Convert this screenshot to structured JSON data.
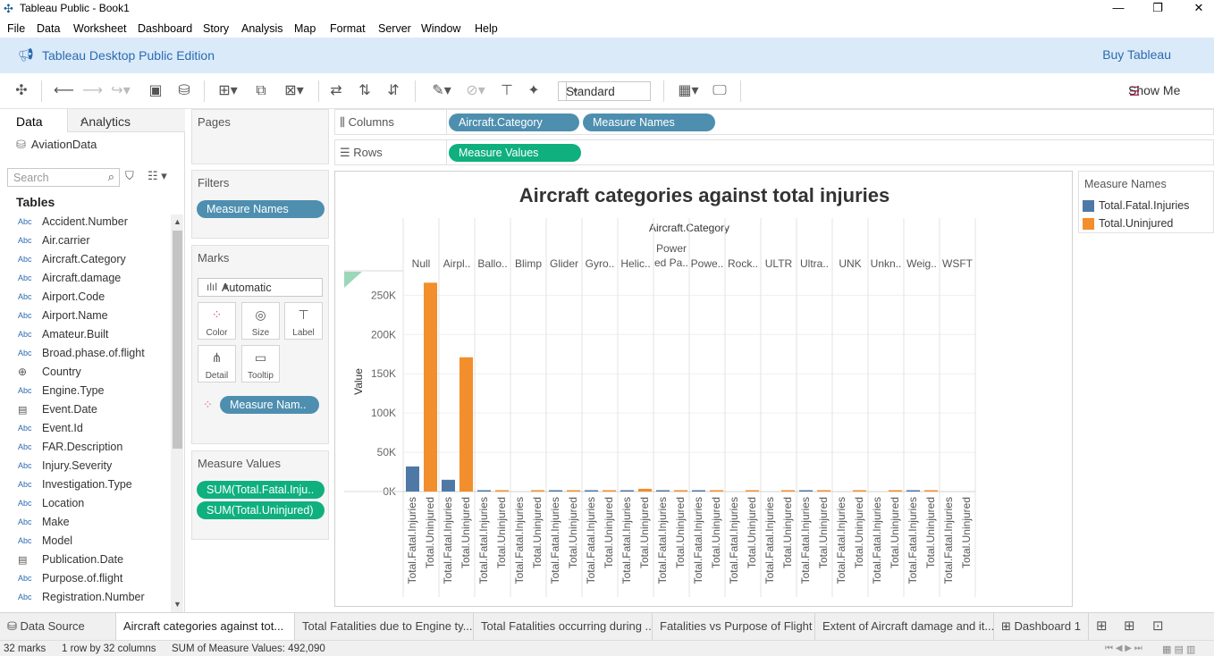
{
  "window": {
    "title": "Tableau Public - Book1",
    "minimize": "—",
    "restore": "❐",
    "close": "✕"
  },
  "menu": [
    "File",
    "Data",
    "Worksheet",
    "Dashboard",
    "Story",
    "Analysis",
    "Map",
    "Format",
    "Server",
    "Window",
    "Help"
  ],
  "banner": {
    "edition": "Tableau Desktop Public Edition",
    "buy": "Buy Tableau"
  },
  "toolbar": {
    "fit": "Standard",
    "show_me": "Show Me"
  },
  "data_pane": {
    "tab_data": "Data",
    "tab_analytics": "Analytics",
    "datasource": "AviationData",
    "search_placeholder": "Search",
    "tables_header": "Tables",
    "fields": [
      {
        "type": "Abc",
        "name": "Accident.Number"
      },
      {
        "type": "Abc",
        "name": "Air.carrier"
      },
      {
        "type": "Abc",
        "name": "Aircraft.Category"
      },
      {
        "type": "Abc",
        "name": "Aircraft.damage"
      },
      {
        "type": "Abc",
        "name": "Airport.Code"
      },
      {
        "type": "Abc",
        "name": "Airport.Name"
      },
      {
        "type": "Abc",
        "name": "Amateur.Built"
      },
      {
        "type": "Abc",
        "name": "Broad.phase.of.flight"
      },
      {
        "type": "globe",
        "name": "Country"
      },
      {
        "type": "Abc",
        "name": "Engine.Type"
      },
      {
        "type": "date",
        "name": "Event.Date"
      },
      {
        "type": "Abc",
        "name": "Event.Id"
      },
      {
        "type": "Abc",
        "name": "FAR.Description"
      },
      {
        "type": "Abc",
        "name": "Injury.Severity"
      },
      {
        "type": "Abc",
        "name": "Investigation.Type"
      },
      {
        "type": "Abc",
        "name": "Location"
      },
      {
        "type": "Abc",
        "name": "Make"
      },
      {
        "type": "Abc",
        "name": "Model"
      },
      {
        "type": "date",
        "name": "Publication.Date"
      },
      {
        "type": "Abc",
        "name": "Purpose.of.flight"
      },
      {
        "type": "Abc",
        "name": "Registration.Number"
      }
    ]
  },
  "cards": {
    "pages": "Pages",
    "filters": "Filters",
    "filter_pill": "Measure Names",
    "marks": "Marks",
    "marks_type": "Automatic",
    "mark_buttons": [
      "Color",
      "Size",
      "Label",
      "Detail",
      "Tooltip"
    ],
    "marks_pill": "Measure Nam..",
    "measure_values": "Measure Values",
    "mv_pills": [
      "SUM(Total.Fatal.Inju..",
      "SUM(Total.Uninjured)"
    ]
  },
  "shelves": {
    "columns_label": "Columns",
    "rows_label": "Rows",
    "columns_pills": [
      "Aircraft.Category",
      "Measure Names"
    ],
    "rows_pills": [
      "Measure Values"
    ]
  },
  "legend": {
    "title": "Measure Names",
    "items": [
      {
        "name": "Total.Fatal.Injuries",
        "color": "#4e79a7"
      },
      {
        "name": "Total.Uninjured",
        "color": "#f28e2b"
      }
    ]
  },
  "chart_data": {
    "type": "bar",
    "title": "Aircraft categories against total injuries",
    "header": "Aircraft.Category",
    "ylabel": "Value",
    "ylim": [
      0,
      280000
    ],
    "yticks": [
      0,
      50000,
      100000,
      150000,
      200000,
      250000
    ],
    "ytick_labels": [
      "0K",
      "50K",
      "100K",
      "150K",
      "200K",
      "250K"
    ],
    "categories": [
      "Null",
      "Airpl..",
      "Ballo..",
      "Blimp",
      "Glider",
      "Gyro..",
      "Helic..",
      "Power\ned Pa..",
      "Powe..",
      "Rock..",
      "ULTR",
      "Ultra..",
      "UNK",
      "Unkn..",
      "Weig..",
      "WSFT"
    ],
    "series": [
      {
        "name": "Total.Fatal.Injuries",
        "color": "#4e79a7",
        "values": [
          32000,
          15000,
          150,
          0,
          100,
          30,
          1500,
          50,
          50,
          0,
          0,
          20,
          0,
          0,
          30,
          0
        ]
      },
      {
        "name": "Total.Uninjured",
        "color": "#f28e2b",
        "values": [
          266000,
          171000,
          900,
          10,
          250,
          100,
          3500,
          200,
          120,
          2,
          2,
          80,
          1,
          2,
          100,
          0
        ]
      }
    ]
  },
  "tabs": [
    "Data Source",
    "Aircraft categories against tot...",
    "Total Fatalities due to Engine ty...",
    "Total Fatalities occurring during ...",
    "Fatalities vs Purpose of Flight",
    "Extent of Aircraft damage and it...",
    "Dashboard 1"
  ],
  "status": {
    "marks": "32 marks",
    "dims": "1 row by 32 columns",
    "sum": "SUM of Measure Values: 492,090"
  }
}
